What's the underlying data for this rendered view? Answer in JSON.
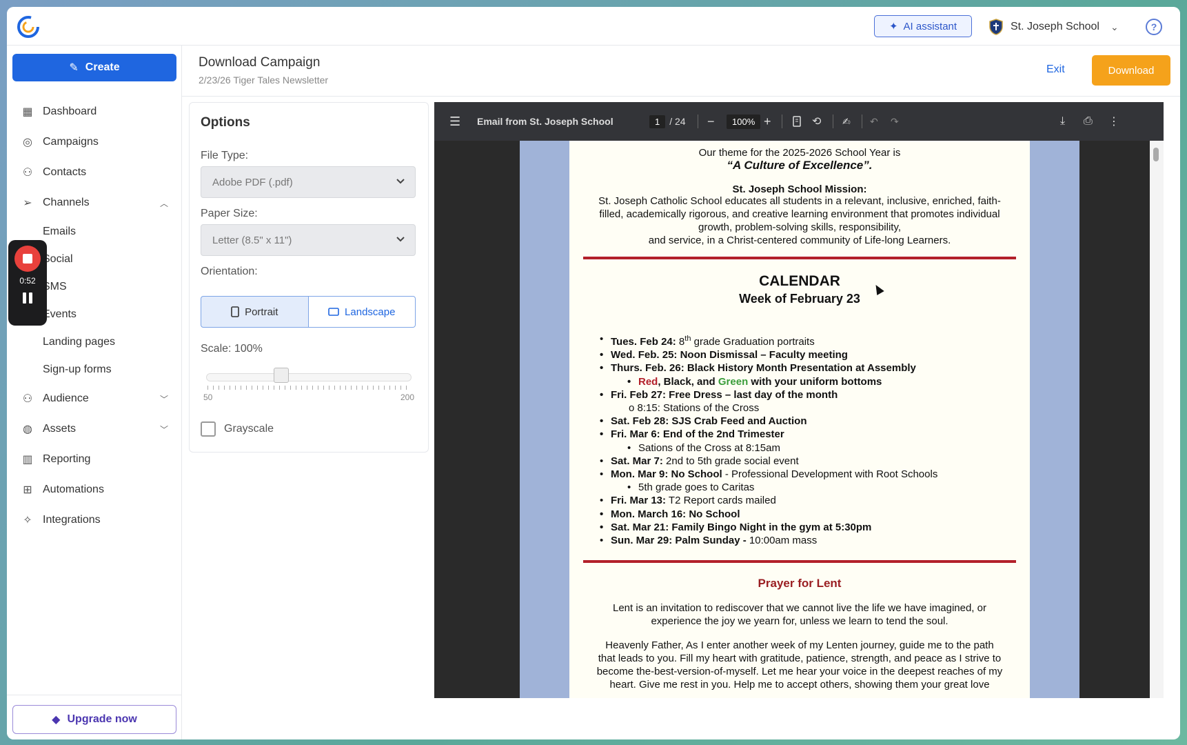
{
  "topbar": {
    "ai_label": "AI assistant",
    "school": "St. Joseph School"
  },
  "sidebar": {
    "create_label": "Create",
    "items": [
      {
        "label": "Dashboard",
        "icon": "dashboard-icon"
      },
      {
        "label": "Campaigns",
        "icon": "campaigns-icon"
      },
      {
        "label": "Contacts",
        "icon": "person-icon"
      },
      {
        "label": "Channels",
        "icon": "send-icon"
      },
      {
        "label": "Audience",
        "icon": "audience-icon"
      },
      {
        "label": "Assets",
        "icon": "palette-icon"
      },
      {
        "label": "Reporting",
        "icon": "chart-icon"
      },
      {
        "label": "Automations",
        "icon": "flow-icon"
      },
      {
        "label": "Integrations",
        "icon": "wrench-icon"
      }
    ],
    "channels": [
      "Emails",
      "Social",
      "SMS",
      "Events",
      "Landing pages",
      "Sign-up forms"
    ],
    "upgrade_label": "Upgrade now"
  },
  "recorder": {
    "time": "0:52"
  },
  "header": {
    "title": "Download Campaign",
    "subtitle": "2/23/26 Tiger Tales Newsletter",
    "exit_label": "Exit",
    "download_label": "Download"
  },
  "options": {
    "title": "Options",
    "file_type_label": "File Type:",
    "file_type_value": "Adobe PDF (.pdf)",
    "paper_size_label": "Paper Size:",
    "paper_size_value": "Letter (8.5\" x 11\")",
    "orientation_label": "Orientation:",
    "portrait_label": "Portrait",
    "landscape_label": "Landscape",
    "scale_label": "Scale: 100%",
    "scale_value": 100,
    "scale_min": "50",
    "scale_max": "200",
    "grayscale_label": "Grayscale"
  },
  "viewer": {
    "doc_title": "Email from St. Joseph School",
    "page_current": "1",
    "page_total": "/ 24",
    "zoom": "100%"
  },
  "doc": {
    "theme_line": "Our theme for the 2025-2026 School Year is",
    "theme": "“A Culture of Excellence”.",
    "mission_title": "St. Joseph School Mission:",
    "mission_1": "St. Joseph Catholic School educates all students in a relevant, inclusive, enriched, faith-",
    "mission_2": "filled, academically rigorous, and creative learning environment that promotes individual",
    "mission_3": "growth, problem-solving skills, responsibility,",
    "mission_4": "and service, in a Christ-centered community of Life-long Learners.",
    "calendar_title": "CALENDAR",
    "calendar_week": "Week of February 23",
    "cal_1_b": "Tues. Feb 24:",
    "cal_1_a": " 8",
    "cal_1_sup": "th",
    "cal_1_c": " grade Graduation portraits",
    "cal_2": "Wed. Feb. 25: Noon Dismissal – Faculty meeting",
    "cal_3": "Thurs. Feb. 26: Black History Month Presentation at Assembly",
    "cal_3s_red": "Red",
    "cal_3s_mid": ", Black, and ",
    "cal_3s_green": "Green",
    "cal_3s_end": " with your uniform bottoms",
    "cal_4": "Fri. Feb 27: Free Dress – last day of the month",
    "cal_4s": "o  8:15: Stations of the Cross",
    "cal_5": "Sat. Feb 28: SJS Crab Feed and Auction",
    "cal_6": "Fri. Mar 6: End of the 2nd Trimester",
    "cal_6s": "Sations of the Cross at 8:15am",
    "cal_7_b": "Sat. Mar 7:",
    "cal_7_a": " 2nd to 5th grade social event",
    "cal_8_b": "Mon. Mar 9: No School",
    "cal_8_a": " - Professional Development with Root Schools",
    "cal_8s": "5th grade goes to Caritas",
    "cal_9_b": "Fri. Mar 13:",
    "cal_9_a": " T2 Report cards mailed",
    "cal_10": "Mon. March 16: No School",
    "cal_11": "Sat. Mar 21: Family Bingo Night in the gym at 5:30pm",
    "cal_12_b": "Sun. Mar 29: Palm Sunday -",
    "cal_12_a": " 10:00am mass",
    "prayer_title": "Prayer for Lent",
    "prayer_1": "Lent is an invitation to rediscover that we cannot live the life we have imagined, or",
    "prayer_2": "experience the joy we yearn for, unless we learn to tend the soul.",
    "prayer_3": "Heavenly Father, As I enter another week of my Lenten journey, guide me to the path",
    "prayer_4": "that leads to you. Fill my heart with gratitude, patience, strength, and peace as I strive to",
    "prayer_5": "become the-best-version-of-myself. Let me hear your voice in the deepest reaches of my",
    "prayer_6": "heart. Give me rest in you. Help me to accept others, showing them your great love"
  },
  "colors": {
    "primary": "#1f66e0",
    "download": "#f5a21b",
    "doc_red": "#b3202a",
    "doc_green": "#3a9d3a"
  }
}
